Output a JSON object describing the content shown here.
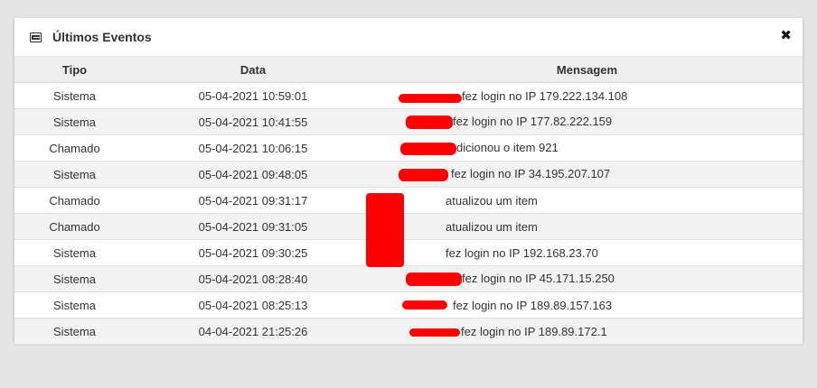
{
  "panel": {
    "title": "Últimos Eventos",
    "close_label": "✖"
  },
  "table": {
    "headers": [
      "Tipo",
      "Data",
      "Mensagem"
    ],
    "rows": [
      {
        "tipo": "Sistema",
        "data": "05-04-2021 10:59:01",
        "msg": "fez login no IP 179.222.134.108"
      },
      {
        "tipo": "Sistema",
        "data": "05-04-2021 10:41:55",
        "msg": "fez login no IP 177.82.222.159"
      },
      {
        "tipo": "Chamado",
        "data": "05-04-2021 10:06:15",
        "msg": "dicionou o item 921"
      },
      {
        "tipo": "Sistema",
        "data": "05-04-2021 09:48:05",
        "msg": "fez login no IP 34.195.207.107"
      },
      {
        "tipo": "Chamado",
        "data": "05-04-2021 09:31:17",
        "msg": "atualizou um item"
      },
      {
        "tipo": "Chamado",
        "data": "05-04-2021 09:31:05",
        "msg": "atualizou um item"
      },
      {
        "tipo": "Sistema",
        "data": "05-04-2021 09:30:25",
        "msg": "fez login no IP 192.168.23.70"
      },
      {
        "tipo": "Sistema",
        "data": "05-04-2021 08:28:40",
        "msg": "fez login no IP 45.171.15.250"
      },
      {
        "tipo": "Sistema",
        "data": "05-04-2021 08:25:13",
        "msg": "fez login no IP 189.89.157.163"
      },
      {
        "tipo": "Sistema",
        "data": "04-04-2021 21:25:26",
        "msg": "fez login no IP 189.89.172.1"
      }
    ]
  },
  "colors": {
    "background": "#e4e4e4",
    "panel": "#ffffff",
    "header_row": "#eeeeee",
    "striped_row": "#f2f2f2",
    "redaction": "#ff0000"
  }
}
